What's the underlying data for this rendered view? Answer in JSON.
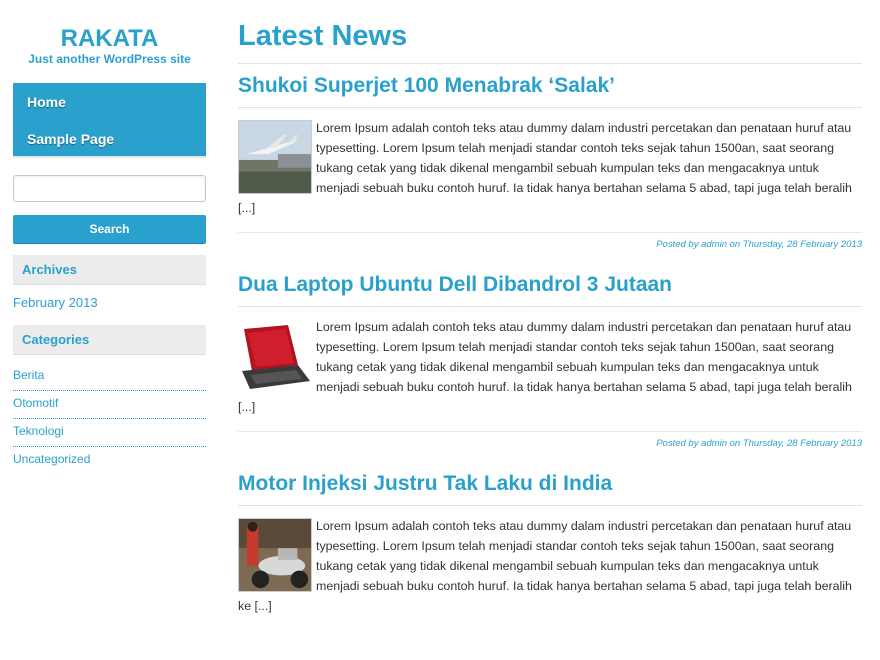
{
  "site": {
    "title": "RAKATA",
    "tagline": "Just another WordPress site"
  },
  "nav": {
    "items": [
      {
        "label": "Home"
      },
      {
        "label": "Sample Page"
      }
    ]
  },
  "search": {
    "value": "",
    "placeholder": "",
    "button_label": "Search"
  },
  "archives": {
    "heading": "Archives",
    "items": [
      {
        "label": "February 2013"
      }
    ]
  },
  "categories": {
    "heading": "Categories",
    "items": [
      {
        "label": "Berita"
      },
      {
        "label": "Otomotif"
      },
      {
        "label": "Teknologi"
      },
      {
        "label": "Uncategorized"
      }
    ]
  },
  "main": {
    "title": "Latest News",
    "posts": [
      {
        "title": "Shukoi Superjet 100 Menabrak ‘Salak’",
        "thumb_icon": "airplane-thumbnail",
        "excerpt": "Lorem Ipsum adalah contoh teks atau dummy dalam industri percetakan dan penataan huruf atau typesetting. Lorem Ipsum telah menjadi standar contoh teks sejak tahun 1500an, saat seorang tukang cetak yang tidak dikenal mengambil sebuah kumpulan teks dan mengacaknya untuk menjadi sebuah buku contoh huruf. Ia tidak hanya bertahan selama 5 abad, tapi juga telah beralih [...]",
        "meta": "Posted by admin on Thursday, 28 February 2013"
      },
      {
        "title": "Dua Laptop Ubuntu Dell Dibandrol 3 Jutaan",
        "thumb_icon": "laptop-thumbnail",
        "excerpt": "Lorem Ipsum adalah contoh teks atau dummy dalam industri percetakan dan penataan huruf atau typesetting. Lorem Ipsum telah menjadi standar contoh teks sejak tahun 1500an, saat seorang tukang cetak yang tidak dikenal mengambil sebuah kumpulan teks dan mengacaknya untuk menjadi sebuah buku contoh huruf. Ia tidak hanya bertahan selama 5 abad, tapi juga telah beralih [...]",
        "meta": "Posted by admin on Thursday, 28 February 2013"
      },
      {
        "title": "Motor Injeksi Justru Tak Laku di India",
        "thumb_icon": "motorcycle-thumbnail",
        "excerpt": "Lorem Ipsum adalah contoh teks atau dummy dalam industri percetakan dan penataan huruf atau typesetting. Lorem Ipsum telah menjadi standar contoh teks sejak tahun 1500an, saat seorang tukang cetak yang tidak dikenal mengambil sebuah kumpulan teks dan mengacaknya untuk menjadi sebuah buku contoh huruf. Ia tidak hanya bertahan selama 5 abad, tapi juga telah beralih ke [...]"
      }
    ]
  },
  "colors": {
    "accent": "#2aa1cd",
    "widget_bg": "#ececec"
  }
}
